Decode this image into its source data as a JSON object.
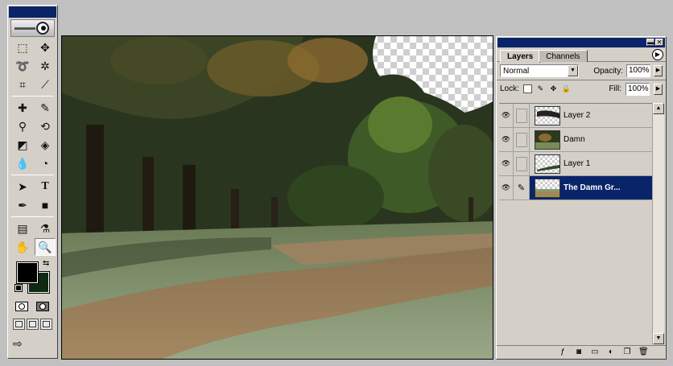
{
  "layers_palette": {
    "tabs": [
      {
        "label": "Layers",
        "active": true
      },
      {
        "label": "Channels",
        "active": false
      }
    ],
    "blend_mode": "Normal",
    "opacity_label": "Opacity:",
    "opacity_value": "100%",
    "lock_label": "Lock:",
    "fill_label": "Fill:",
    "fill_value": "100%",
    "layers": [
      {
        "name": "Layer 2",
        "visible": true,
        "selected": false
      },
      {
        "name": "Damn",
        "visible": true,
        "selected": false
      },
      {
        "name": "Layer 1",
        "visible": true,
        "selected": false
      },
      {
        "name": "The Damn Gr...",
        "visible": true,
        "selected": true
      }
    ]
  },
  "colors": {
    "foreground": "#000000",
    "background": "#0e2a12",
    "selection": "#0a246a",
    "title_bar": "#0a246a",
    "panel": "#d4d0c8"
  },
  "tools": {
    "rows": [
      [
        "marquee-icon",
        "move-icon"
      ],
      [
        "lasso-icon",
        "magic-wand-icon"
      ],
      [
        "crop-icon",
        "slice-icon"
      ],
      [
        "healing-brush-icon",
        "brush-icon"
      ],
      [
        "clone-stamp-icon",
        "history-brush-icon"
      ],
      [
        "eraser-icon",
        "paint-bucket-icon"
      ],
      [
        "blur-icon",
        "dodge-icon"
      ],
      [
        "path-select-icon",
        "type-icon"
      ],
      [
        "pen-icon",
        "rectangle-icon"
      ],
      [
        "notes-icon",
        "eyedropper-icon"
      ],
      [
        "hand-icon",
        "zoom-icon"
      ]
    ],
    "active": "zoom-icon"
  }
}
